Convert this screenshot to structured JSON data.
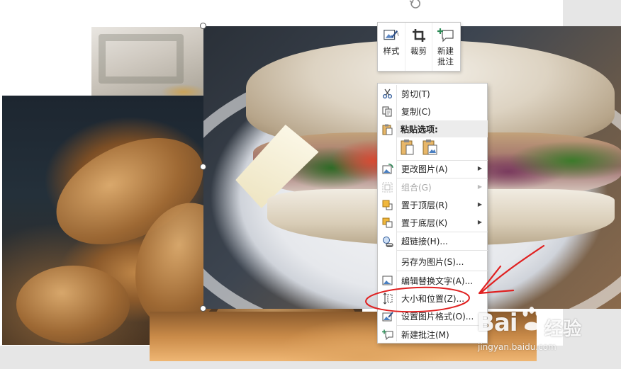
{
  "mini_toolbar": {
    "style_label": "样式",
    "crop_label": "裁剪",
    "new_comment_label": "新建\n批注"
  },
  "context_menu": {
    "cut": "剪切(T)",
    "copy": "复制(C)",
    "paste_options_header": "粘贴选项:",
    "change_picture": "更改图片(A)",
    "group": "组合(G)",
    "bring_to_front": "置于顶层(R)",
    "send_to_back": "置于底层(K)",
    "hyperlink": "超链接(H)...",
    "save_as_picture": "另存为图片(S)...",
    "edit_alt_text": "编辑替换文字(A)...",
    "size_and_position": "大小和位置(Z)...",
    "format_picture": "设置图片格式(O)...",
    "new_comment": "新建批注(M)"
  },
  "watermark": {
    "brand": "Bai",
    "brand_cn": "经验",
    "url": "jingyan.baidu.com"
  },
  "colors": {
    "annotation_red": "#e02020",
    "menu_header_bg": "#ececec",
    "disabled_text": "#a8a8a8"
  },
  "icons": {
    "rotate": "rotate-handle-icon",
    "style": "picture-style-icon",
    "crop": "crop-icon",
    "new_comment": "new-comment-icon",
    "cut": "scissors-icon",
    "copy": "copy-icon",
    "paste": "clipboard-icon"
  }
}
